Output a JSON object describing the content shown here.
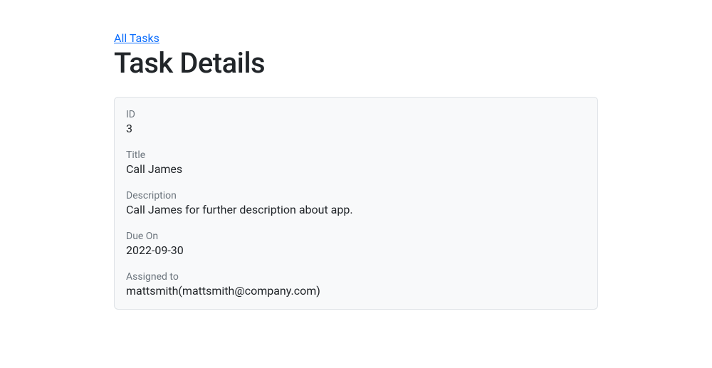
{
  "breadcrumb": {
    "all_tasks": "All Tasks"
  },
  "header": {
    "title": "Task Details"
  },
  "labels": {
    "id": "ID",
    "title": "Title",
    "description": "Description",
    "due_on": "Due On",
    "assigned_to": "Assigned to"
  },
  "task": {
    "id": "3",
    "title": "Call James",
    "description": "Call James for further description about app.",
    "due_on": "2022-09-30",
    "assigned_to": "mattsmith(mattsmith@company.com)"
  }
}
